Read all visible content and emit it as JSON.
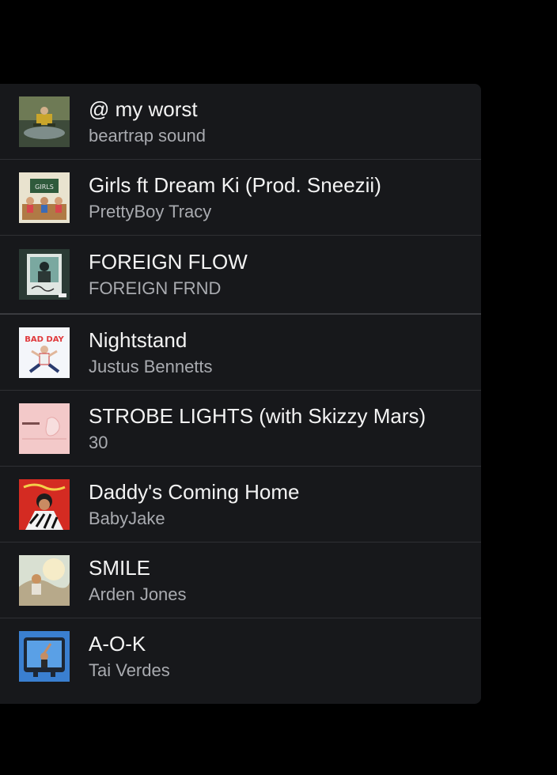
{
  "tracks": [
    {
      "title": "@ my worst",
      "artist": "beartrap sound",
      "art_icon": "album-art-swamp-icon"
    },
    {
      "title": "Girls ft Dream Ki (Prod. Sneezii)",
      "artist": "PrettyBoy Tracy",
      "art_icon": "album-art-classroom-icon"
    },
    {
      "title": "FOREIGN FLOW",
      "artist": "FOREIGN FRND",
      "art_icon": "album-art-polaroid-icon"
    },
    {
      "title": "Nightstand",
      "artist": "Justus Bennetts",
      "art_icon": "album-art-bad-day-icon"
    },
    {
      "title": "STROBE LIGHTS (with Skizzy Mars)",
      "artist": "30",
      "art_icon": "album-art-pink-icon"
    },
    {
      "title": "Daddy's Coming Home",
      "artist": "BabyJake",
      "art_icon": "album-art-red-zebra-icon"
    },
    {
      "title": "SMILE",
      "artist": "Arden Jones",
      "art_icon": "album-art-sunlight-icon"
    },
    {
      "title": "A-O-K",
      "artist": "Tai Verdes",
      "art_icon": "album-art-tv-icon"
    }
  ],
  "art_labels": {
    "girls": "GIRLS",
    "bad_day": "BAD DAY"
  },
  "colors": {
    "background": "#000000",
    "panel": "#17181b",
    "divider": "#2f3034",
    "title_text": "#f3f3f3",
    "artist_text": "#a9abb0"
  }
}
